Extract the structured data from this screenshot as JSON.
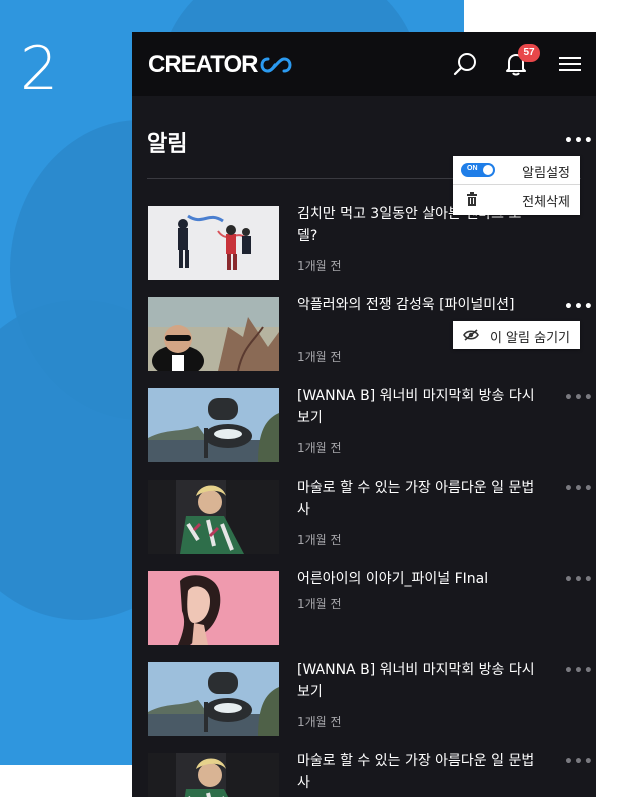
{
  "step": "2",
  "brand": {
    "wordmark": "CREATOR"
  },
  "header": {
    "notification_count": "57",
    "search_icon": "search-icon",
    "bell_icon": "bell-icon",
    "menu_icon": "hamburger-menu-icon"
  },
  "page": {
    "title": "알림"
  },
  "settings_menu": {
    "toggle_state": "ON",
    "settings_label": "알림설정",
    "delete_all_label": "전체삭제"
  },
  "hide_menu": {
    "label": "이 알림 숨기기"
  },
  "notifications": [
    {
      "title": "김치만 먹고 3일동안 살아본 덴마크 모델?",
      "time": "1개월 전"
    },
    {
      "title": "악플러와의 전쟁 감성욱 [파이널미션]",
      "time": "1개월 전"
    },
    {
      "title": "[WANNA B] 워너비 마지막회 방송 다시보기",
      "time": "1개월 전"
    },
    {
      "title": "마술로 할 수 있는 가장 아름다운 일 문법사",
      "time": "1개월 전"
    },
    {
      "title": "어른아이의 이야기_파이널 FInal",
      "time": "1개월 전"
    },
    {
      "title": "[WANNA B] 워너비 마지막회 방송 다시보기",
      "time": "1개월 전"
    },
    {
      "title": "마술로 할 수 있는 가장 아름다운 일 문법사",
      "time": ""
    }
  ],
  "colors": {
    "background_blue": "#2f96de",
    "app_bg": "#17171c",
    "badge_red": "#e8474a",
    "toggle_blue": "#1f7ee8"
  }
}
